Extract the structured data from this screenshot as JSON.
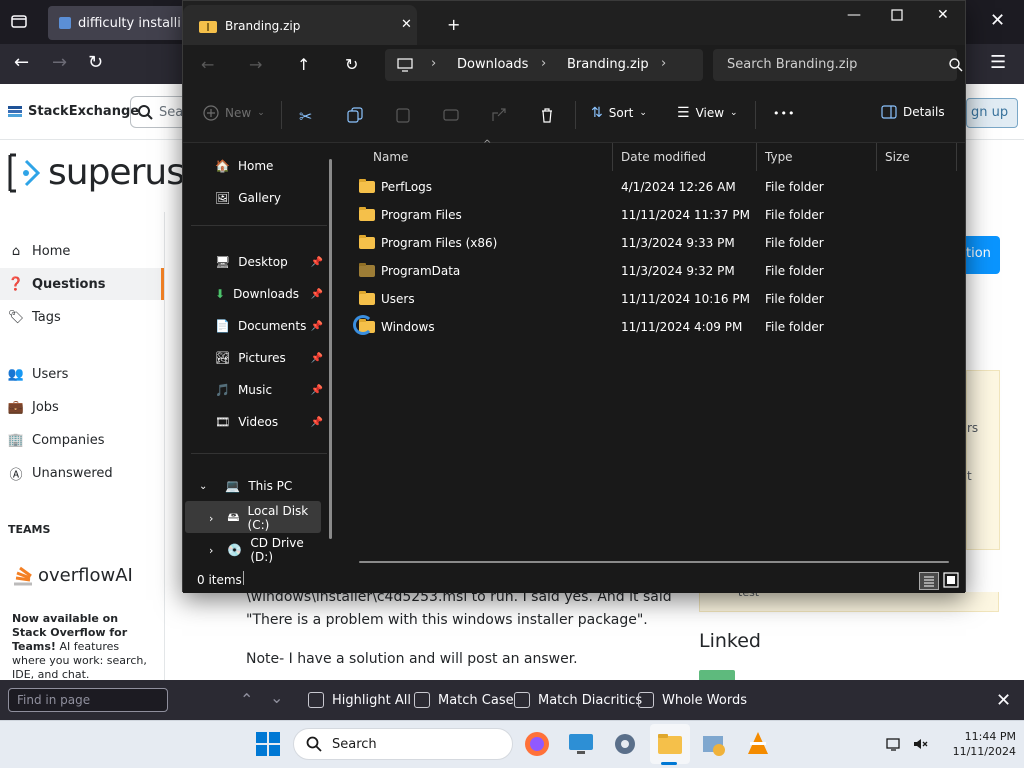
{
  "browser": {
    "tab_title": "difficulty installing m",
    "new_tab": "+",
    "url_visible": ""
  },
  "site": {
    "stackexchange": "StackExchange",
    "search_placeholder": "Sea",
    "logo_text": "superus",
    "signup": "gn up",
    "ask_fragment": "tion",
    "nav": {
      "home": "Home",
      "questions": "Questions",
      "tags": "Tags",
      "users": "Users",
      "jobs": "Jobs",
      "companies": "Companies",
      "unanswered": "Unanswered"
    },
    "teams_heading": "TEAMS",
    "overflow_ai": "overflowAI",
    "promo_title": "Now available on Stack Overflow for Teams!",
    "promo_body": " AI features where you work: search, IDE, and chat.",
    "body_line1": "\\windows\\installer\\c4d5253.msi to run. I said yes. And it said",
    "body_line2": "\"There is a problem with this windows installer package\".",
    "body_line3": "Note- I have a solution and will post an answer.",
    "linked_heading": "Linked",
    "side_fragments": [
      "rs",
      "t",
      "test"
    ]
  },
  "findbar": {
    "placeholder": "Find in page",
    "options": [
      "Highlight All",
      "Match Case",
      "Match Diacritics",
      "Whole Words"
    ]
  },
  "taskbar": {
    "search": "Search",
    "time": "11:44 PM",
    "date": "11/11/2024"
  },
  "explorer": {
    "title": "Branding.zip",
    "breadcrumb": [
      "Downloads",
      "Branding.zip"
    ],
    "search_placeholder": "Search Branding.zip",
    "commands": {
      "new": "New",
      "sort": "Sort",
      "view": "View",
      "more": "•••",
      "details": "Details"
    },
    "sidebar": {
      "home": "Home",
      "gallery": "Gallery",
      "desktop": "Desktop",
      "downloads": "Downloads",
      "documents": "Documents",
      "pictures": "Pictures",
      "music": "Music",
      "videos": "Videos",
      "this_pc": "This PC",
      "local_disk": "Local Disk (C:)",
      "cd_drive": "CD Drive (D:)"
    },
    "columns": [
      "Name",
      "Date modified",
      "Type",
      "Size"
    ],
    "files": [
      {
        "name": "PerfLogs",
        "date": "4/1/2024 12:26 AM",
        "type": "File folder"
      },
      {
        "name": "Program Files",
        "date": "11/11/2024 11:37 PM",
        "type": "File folder"
      },
      {
        "name": "Program Files (x86)",
        "date": "11/3/2024 9:33 PM",
        "type": "File folder"
      },
      {
        "name": "ProgramData",
        "date": "11/3/2024 9:32 PM",
        "type": "File folder"
      },
      {
        "name": "Users",
        "date": "11/11/2024 10:16 PM",
        "type": "File folder"
      },
      {
        "name": "Windows",
        "date": "11/11/2024 4:09 PM",
        "type": "File folder"
      }
    ],
    "status": "0 items"
  },
  "colors": {
    "accent": "#0a95ff",
    "folder": "#f5c04a",
    "firefox_bg": "#2b2a33"
  }
}
